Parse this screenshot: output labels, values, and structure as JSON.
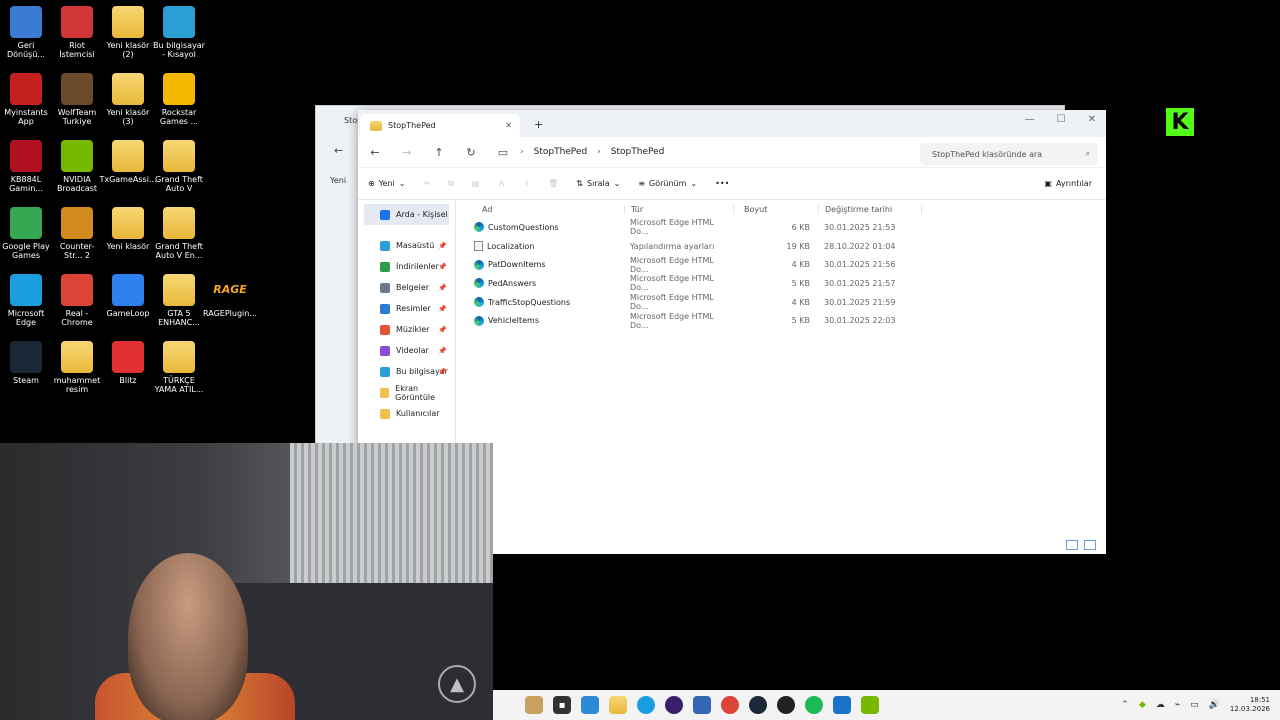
{
  "desktop": {
    "icons": [
      {
        "label": "Geri Dönüşü...",
        "icon": "recycle-bin-icon"
      },
      {
        "label": "Riot İstemcisi",
        "icon": "riot-icon"
      },
      {
        "label": "Yeni klasör (2)",
        "icon": "folder-icon"
      },
      {
        "label": "Bu bilgisayar - Kısayol",
        "icon": "computer-icon"
      },
      {
        "label": "Myinstants App",
        "icon": "myinstants-icon"
      },
      {
        "label": "WolfTeam Turkiye",
        "icon": "wolfteam-icon"
      },
      {
        "label": "Yeni klasör (3)",
        "icon": "folder-icon"
      },
      {
        "label": "Rockstar Games ...",
        "icon": "rockstar-icon"
      },
      {
        "label": "KB884L Gamin...",
        "icon": "kb-icon"
      },
      {
        "label": "NVIDIA Broadcast",
        "icon": "nvidia-icon"
      },
      {
        "label": "TxGameAssi...",
        "icon": "folder-icon"
      },
      {
        "label": "Grand Theft Auto V",
        "icon": "folder-icon"
      },
      {
        "label": "Google Play Games",
        "icon": "google-play-icon"
      },
      {
        "label": "Counter-Str... 2",
        "icon": "counter-strike-icon"
      },
      {
        "label": "Yeni klasör",
        "icon": "folder-icon"
      },
      {
        "label": "Grand Theft Auto V En...",
        "icon": "folder-icon"
      },
      {
        "label": "Microsoft Edge",
        "icon": "edge-icon"
      },
      {
        "label": "Real - Chrome",
        "icon": "chrome-icon"
      },
      {
        "label": "GameLoop",
        "icon": "gameloop-icon"
      },
      {
        "label": "GTA 5 ENHANC...",
        "icon": "folder-icon"
      },
      {
        "label": "RAGEPlugin...",
        "icon": "rage-icon"
      },
      {
        "label": "Steam",
        "icon": "steam-icon"
      },
      {
        "label": "muhammet resim",
        "icon": "folder-icon"
      },
      {
        "label": "Blitz",
        "icon": "blitz-icon"
      },
      {
        "label": "TÜRKÇE YAMA ATIL...",
        "icon": "folder-icon"
      }
    ],
    "rage_text": "RAGE",
    "kick_logo": "K"
  },
  "bgwindow": {
    "tab_fragment": "Stop",
    "new_fragment": "Yeni"
  },
  "explorer": {
    "tab_title": "StopThePed",
    "new_tab": "+",
    "window_controls": {
      "minimize": "—",
      "maximize": "☐",
      "close": "✕"
    },
    "breadcrumb": [
      "StopThePed",
      "StopThePed"
    ],
    "search_placeholder": "StopThePed klasöründe ara",
    "toolbar": {
      "new": "Yeni",
      "sort": "Sırala",
      "view": "Görünüm",
      "more": "•••",
      "details": "Ayrıntılar"
    },
    "nav": [
      {
        "label": "Arda - Kişisel",
        "icon": "onedrive-icon",
        "pinned": false
      },
      {
        "label": "Masaüstü",
        "icon": "desktop-icon",
        "pinned": true
      },
      {
        "label": "İndirilenler",
        "icon": "download-icon",
        "pinned": true
      },
      {
        "label": "Belgeler",
        "icon": "documents-icon",
        "pinned": true
      },
      {
        "label": "Resimler",
        "icon": "pictures-icon",
        "pinned": true
      },
      {
        "label": "Müzikler",
        "icon": "music-icon",
        "pinned": true
      },
      {
        "label": "Videolar",
        "icon": "videos-icon",
        "pinned": true
      },
      {
        "label": "Bu bilgisayar",
        "icon": "computer-icon",
        "pinned": true
      },
      {
        "label": "Ekran Görüntüle",
        "icon": "folder-icon",
        "pinned": false
      },
      {
        "label": "Kullanıcılar",
        "icon": "folder-icon",
        "pinned": false
      }
    ],
    "columns": {
      "name": "Ad",
      "type": "Tür",
      "size": "Boyut",
      "date": "Değiştirme tarihi"
    },
    "files": [
      {
        "name": "CustomQuestions",
        "type": "Microsoft Edge HTML Do...",
        "size": "6 KB",
        "date": "30.01.2025 21:53",
        "icon": "edge"
      },
      {
        "name": "Localization",
        "type": "Yapılandırma ayarları",
        "size": "19 KB",
        "date": "28.10.2022 01:04",
        "icon": "config"
      },
      {
        "name": "PatDownItems",
        "type": "Microsoft Edge HTML Do...",
        "size": "4 KB",
        "date": "30.01.2025 21:56",
        "icon": "edge"
      },
      {
        "name": "PedAnswers",
        "type": "Microsoft Edge HTML Do...",
        "size": "5 KB",
        "date": "30.01.2025 21:57",
        "icon": "edge"
      },
      {
        "name": "TrafficStopQuestions",
        "type": "Microsoft Edge HTML Do...",
        "size": "4 KB",
        "date": "30.01.2025 21:59",
        "icon": "edge"
      },
      {
        "name": "VehicleItems",
        "type": "Microsoft Edge HTML Do...",
        "size": "5 KB",
        "date": "30.01.2025 22:03",
        "icon": "edge"
      }
    ]
  },
  "taskbar": {
    "clock_time": "18:51",
    "clock_date": "12.03.2026"
  },
  "colors": {
    "accent": "#0067c0",
    "kick": "#53fc18",
    "folder": "#f0c14b"
  }
}
